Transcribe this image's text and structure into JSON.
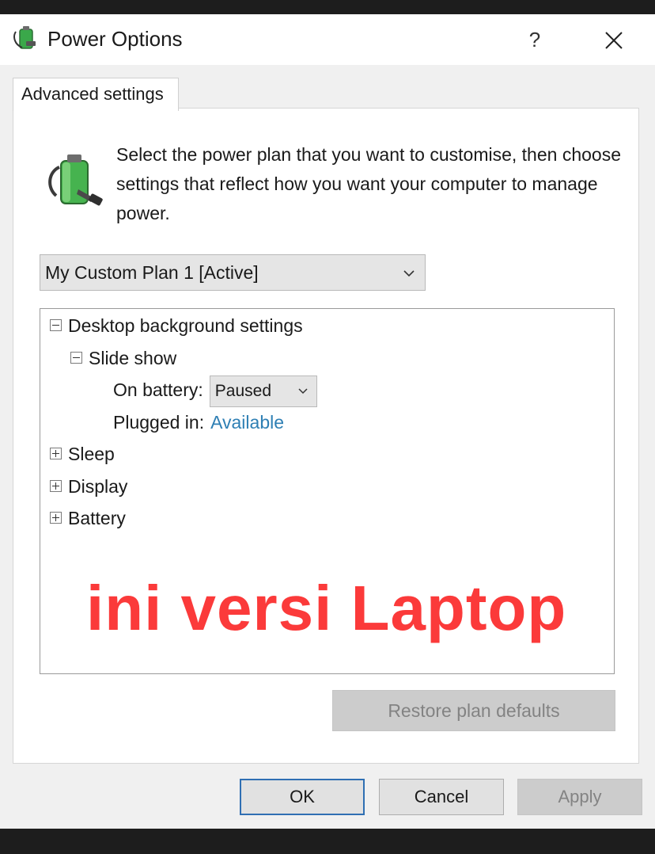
{
  "window": {
    "title": "Power Options",
    "help_label": "?",
    "close_label": "✕"
  },
  "tab": {
    "label": "Advanced settings"
  },
  "description": "Select the power plan that you want to customise, then choose settings that reflect how you want your computer to manage power.",
  "plan_select": {
    "value": "My Custom Plan 1 [Active]"
  },
  "tree": {
    "desktop_background": "Desktop background settings",
    "slide_show": "Slide show",
    "on_battery_label": "On battery:",
    "on_battery_value": "Paused",
    "plugged_in_label": "Plugged in:",
    "plugged_in_value": "Available",
    "sleep": "Sleep",
    "display": "Display",
    "battery": "Battery"
  },
  "overlay_text": "ini versi Laptop",
  "buttons": {
    "restore": "Restore plan defaults",
    "ok": "OK",
    "cancel": "Cancel",
    "apply": "Apply"
  },
  "colors": {
    "overlay": "#fb3a3a",
    "link": "#2e7fb4",
    "ok_border": "#2f6fb3"
  }
}
